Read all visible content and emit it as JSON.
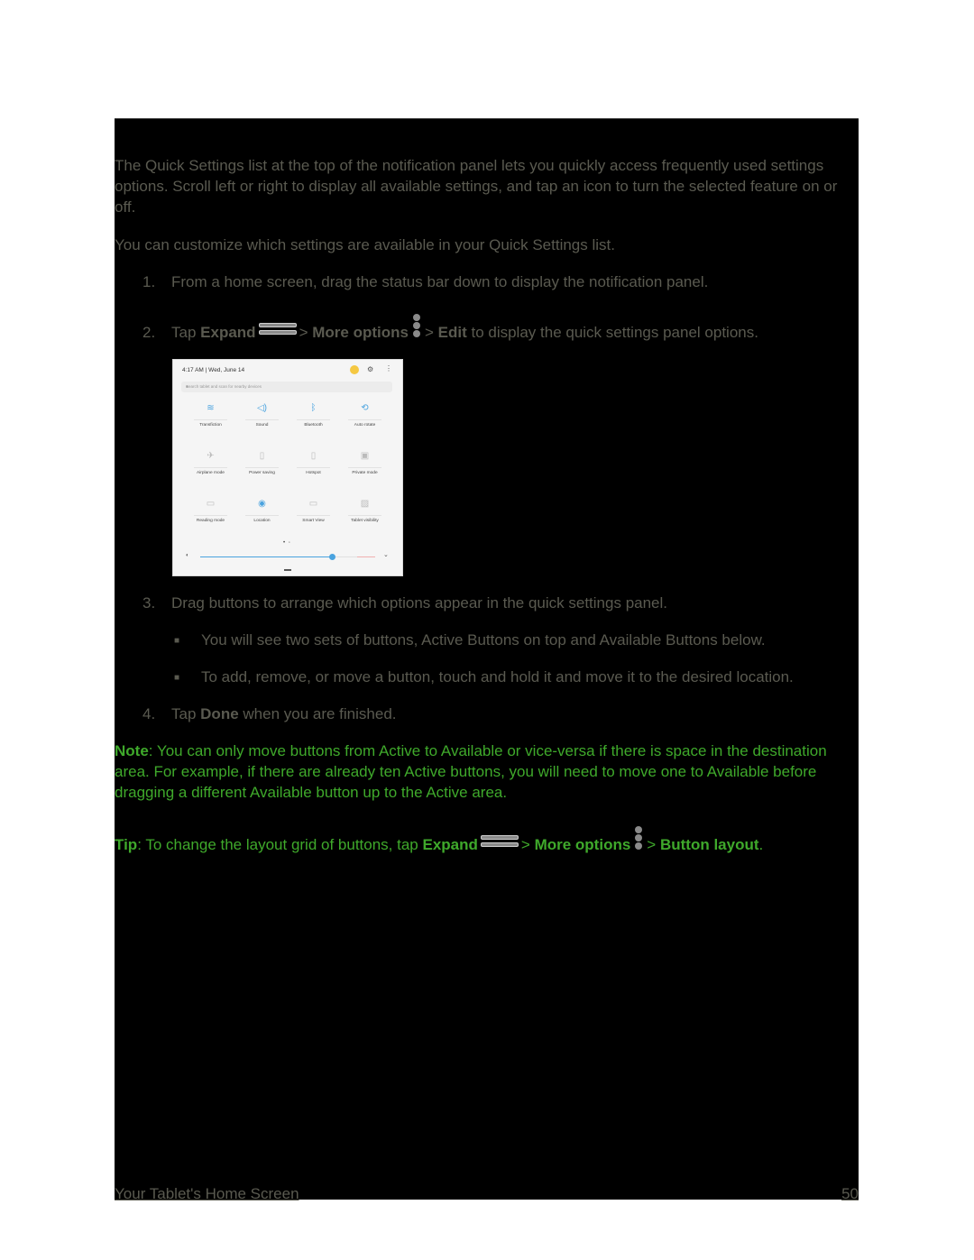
{
  "intro": "The Quick Settings list at the top of the notification panel lets you quickly access frequently used settings options. Scroll left or right to display all available settings, and tap an icon to turn the selected feature on or off.",
  "customize": "You can customize which settings are available in your Quick Settings list.",
  "steps": [
    {
      "num": "1.",
      "text": "From a home screen, drag the status bar down to display the notification panel."
    },
    {
      "num": "2.",
      "tap": "Tap",
      "expand": "Expand",
      "sep1": ">",
      "more_options": "More options",
      "sep2": ">",
      "edit": "Edit",
      "rest": "to display the quick settings panel options."
    },
    {
      "num": "3.",
      "text": "Drag buttons to arrange which options appear in the quick settings panel."
    },
    {
      "num": "4.",
      "tap": "Tap",
      "done": "Done",
      "rest": "when you are finished."
    }
  ],
  "bullets": [
    "You will see two sets of buttons, Active Buttons on top and Available Buttons below.",
    "To add, remove, or move a button, touch and hold it and move it to the desired location."
  ],
  "screenshot": {
    "time": "4:17 AM",
    "date": "Wed, June 14",
    "search_placeholder": "Search tablet and scan for nearby devices",
    "tiles": [
      {
        "label": "Transfiction",
        "icon": "wifi-icon"
      },
      {
        "label": "Sound",
        "icon": "sound-icon"
      },
      {
        "label": "Bluetooth",
        "icon": "bluetooth-icon"
      },
      {
        "label": "Auto rotate",
        "icon": "auto-rotate-icon"
      },
      {
        "label": "Airplane mode",
        "icon": "airplane-icon"
      },
      {
        "label": "Power saving",
        "icon": "battery-icon"
      },
      {
        "label": "Hotspot",
        "icon": "hotspot-icon"
      },
      {
        "label": "Private mode",
        "icon": "private-mode-icon"
      },
      {
        "label": "Reading mode",
        "icon": "book-icon"
      },
      {
        "label": "Location",
        "icon": "location-icon"
      },
      {
        "label": "Smart View",
        "icon": "smart-view-icon"
      },
      {
        "label": "Tablet visibility",
        "icon": "visibility-icon"
      }
    ],
    "brightness_level": 0.75,
    "pager": "• ◦"
  },
  "note": {
    "label": "Note",
    "text": ": You can only move buttons from Active to Available or vice-versa if there is space in the destination area. For example, if there are already ten Active buttons, you will need to move one to Available before dragging a different Available button up to the Active area."
  },
  "tip": {
    "label": "Tip",
    "text": ": To change the layout grid of buttons, tap",
    "expand": "Expand",
    "sep1": ">",
    "more_options": "More options",
    "sep2": ">",
    "button_layout": "Button layout",
    "end": "."
  },
  "footer": {
    "section": "Your Tablet's Home Screen",
    "page": "50"
  }
}
